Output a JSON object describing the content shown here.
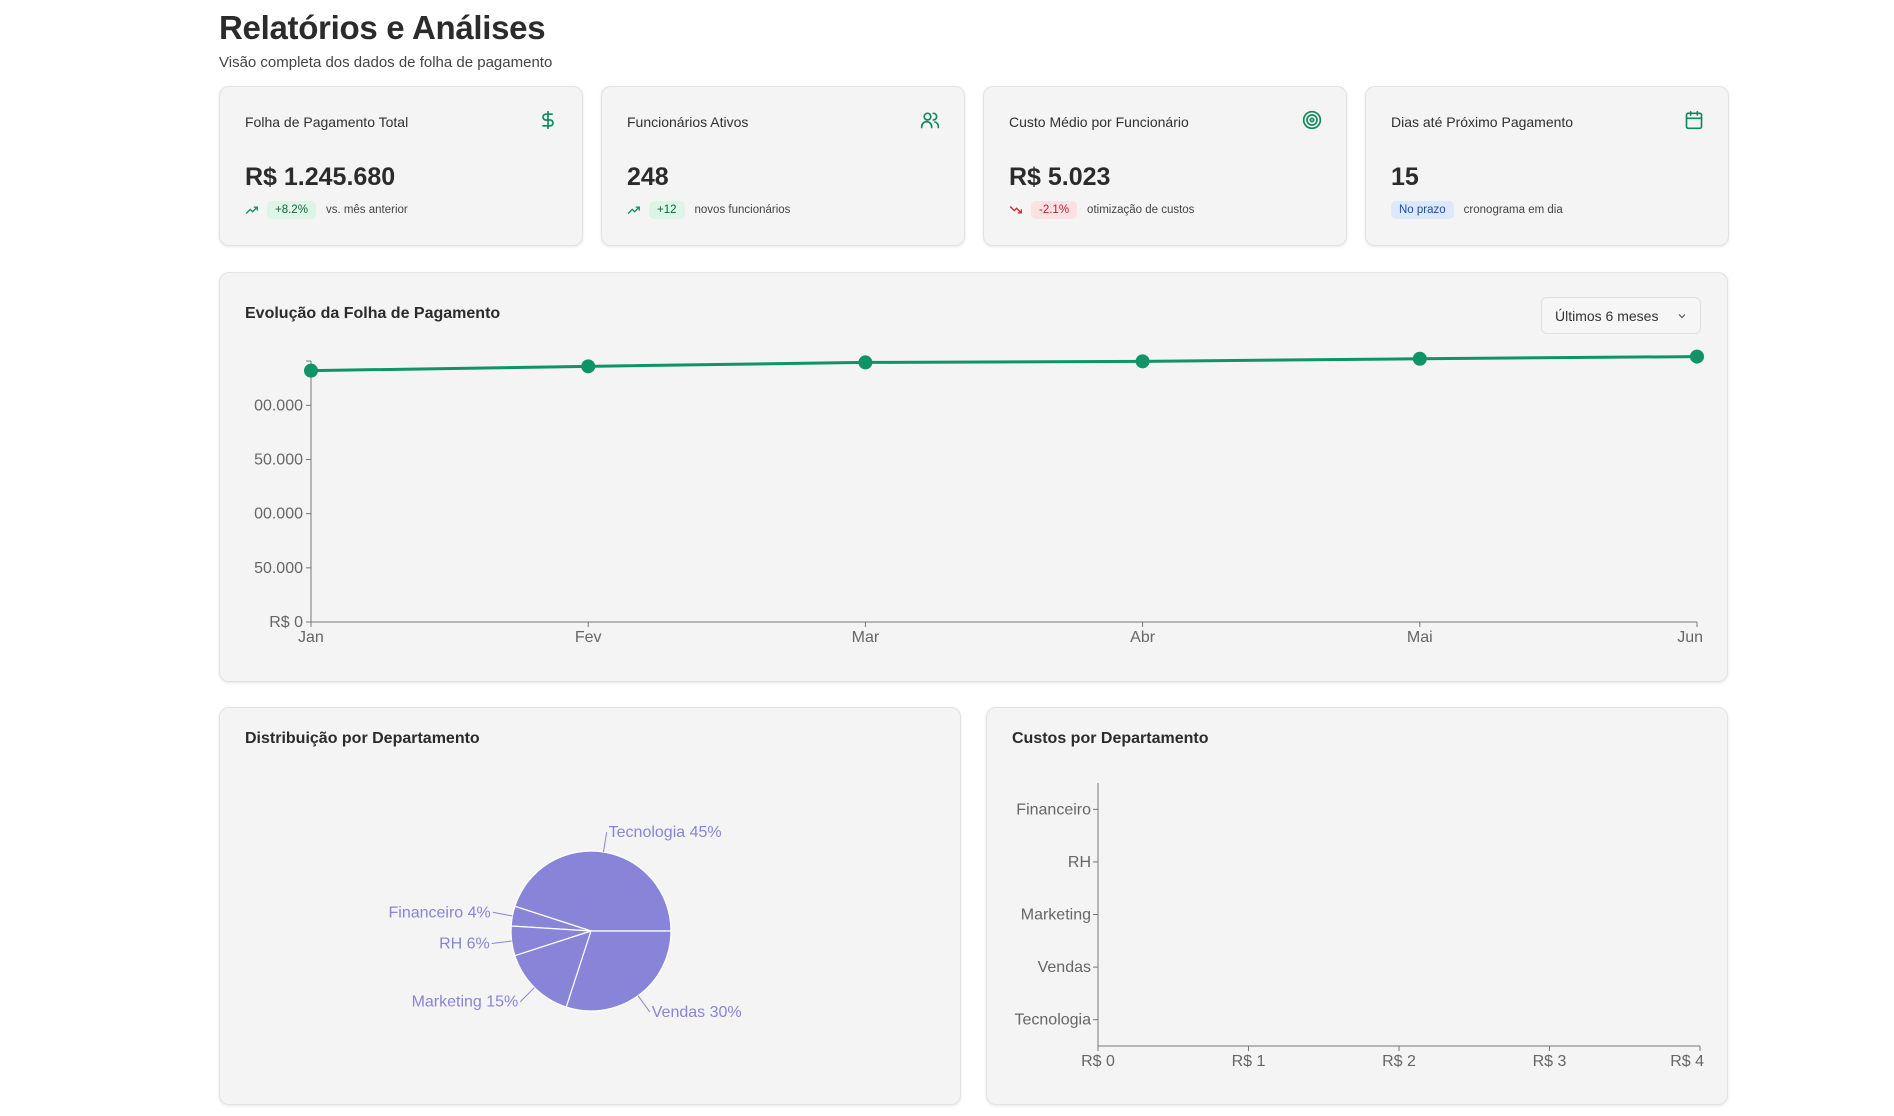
{
  "header": {
    "title": "Relatórios e Análises",
    "subtitle": "Visão completa dos dados de folha de pagamento"
  },
  "kpis": [
    {
      "title": "Folha de Pagamento Total",
      "icon": "dollar-icon",
      "value": "R$ 1.245.680",
      "trend": "up",
      "badge": "+8.2%",
      "badge_color": "green",
      "note": "vs. mês anterior"
    },
    {
      "title": "Funcionários Ativos",
      "icon": "users-icon",
      "value": "248",
      "trend": "up",
      "badge": "+12",
      "badge_color": "green",
      "note": "novos funcionários"
    },
    {
      "title": "Custo Médio por Funcionário",
      "icon": "target-icon",
      "value": "R$ 5.023",
      "trend": "down",
      "badge": "-2.1%",
      "badge_color": "red",
      "note": "otimização de custos"
    },
    {
      "title": "Dias até Próximo Pagamento",
      "icon": "calendar-icon",
      "value": "15",
      "trend": "none",
      "badge": "No prazo",
      "badge_color": "blue",
      "note": "cronograma em dia"
    }
  ],
  "colors": {
    "accent": "#0d8a5e",
    "line": "#0f9467",
    "pie": "#8884d8",
    "pie_label": "#8884d8"
  },
  "evolution": {
    "title": "Evolução da Folha de Pagamento",
    "period_select": "Últimos 6 meses"
  },
  "distribution": {
    "title": "Distribuição por Departamento"
  },
  "costs": {
    "title": "Custos por Departamento"
  },
  "chart_data": [
    {
      "type": "line",
      "title": "Evolução da Folha de Pagamento",
      "categories": [
        "Jan",
        "Fev",
        "Mar",
        "Abr",
        "Mai",
        "Jun"
      ],
      "values": [
        1160000,
        1180000,
        1198000,
        1203000,
        1215000,
        1225000
      ],
      "ylim": [
        0,
        1200000
      ],
      "yticks": [
        0,
        250000,
        500000,
        750000,
        1000000
      ],
      "ytick_labels": [
        "R$ 0",
        "50.000",
        "00.000",
        "50.000",
        "00.000"
      ],
      "grid": false
    },
    {
      "type": "pie",
      "title": "Distribuição por Departamento",
      "slices": [
        {
          "label": "Tecnologia",
          "value": 45,
          "text": "Tecnologia 45%"
        },
        {
          "label": "Financeiro",
          "value": 4,
          "text": "Financeiro 4%"
        },
        {
          "label": "RH",
          "value": 6,
          "text": "RH 6%"
        },
        {
          "label": "Marketing",
          "value": 15,
          "text": "Marketing 15%"
        },
        {
          "label": "Vendas",
          "value": 30,
          "text": "Vendas 30%"
        }
      ]
    },
    {
      "type": "bar",
      "title": "Custos por Departamento",
      "orientation": "horizontal",
      "categories": [
        "Financeiro",
        "RH",
        "Marketing",
        "Vendas",
        "Tecnologia"
      ],
      "category_labels": [
        "Financeiro",
        "RH",
        "Marketing",
        "Vendas",
        "Tecnologia"
      ],
      "values": [
        0,
        0,
        0,
        0,
        0
      ],
      "xlim": [
        0,
        4
      ],
      "xticks": [
        0,
        1,
        2,
        3,
        4
      ],
      "xtick_labels": [
        "R$ 0",
        "R$ 1",
        "R$ 2",
        "R$ 3",
        "R$ 4"
      ]
    }
  ]
}
